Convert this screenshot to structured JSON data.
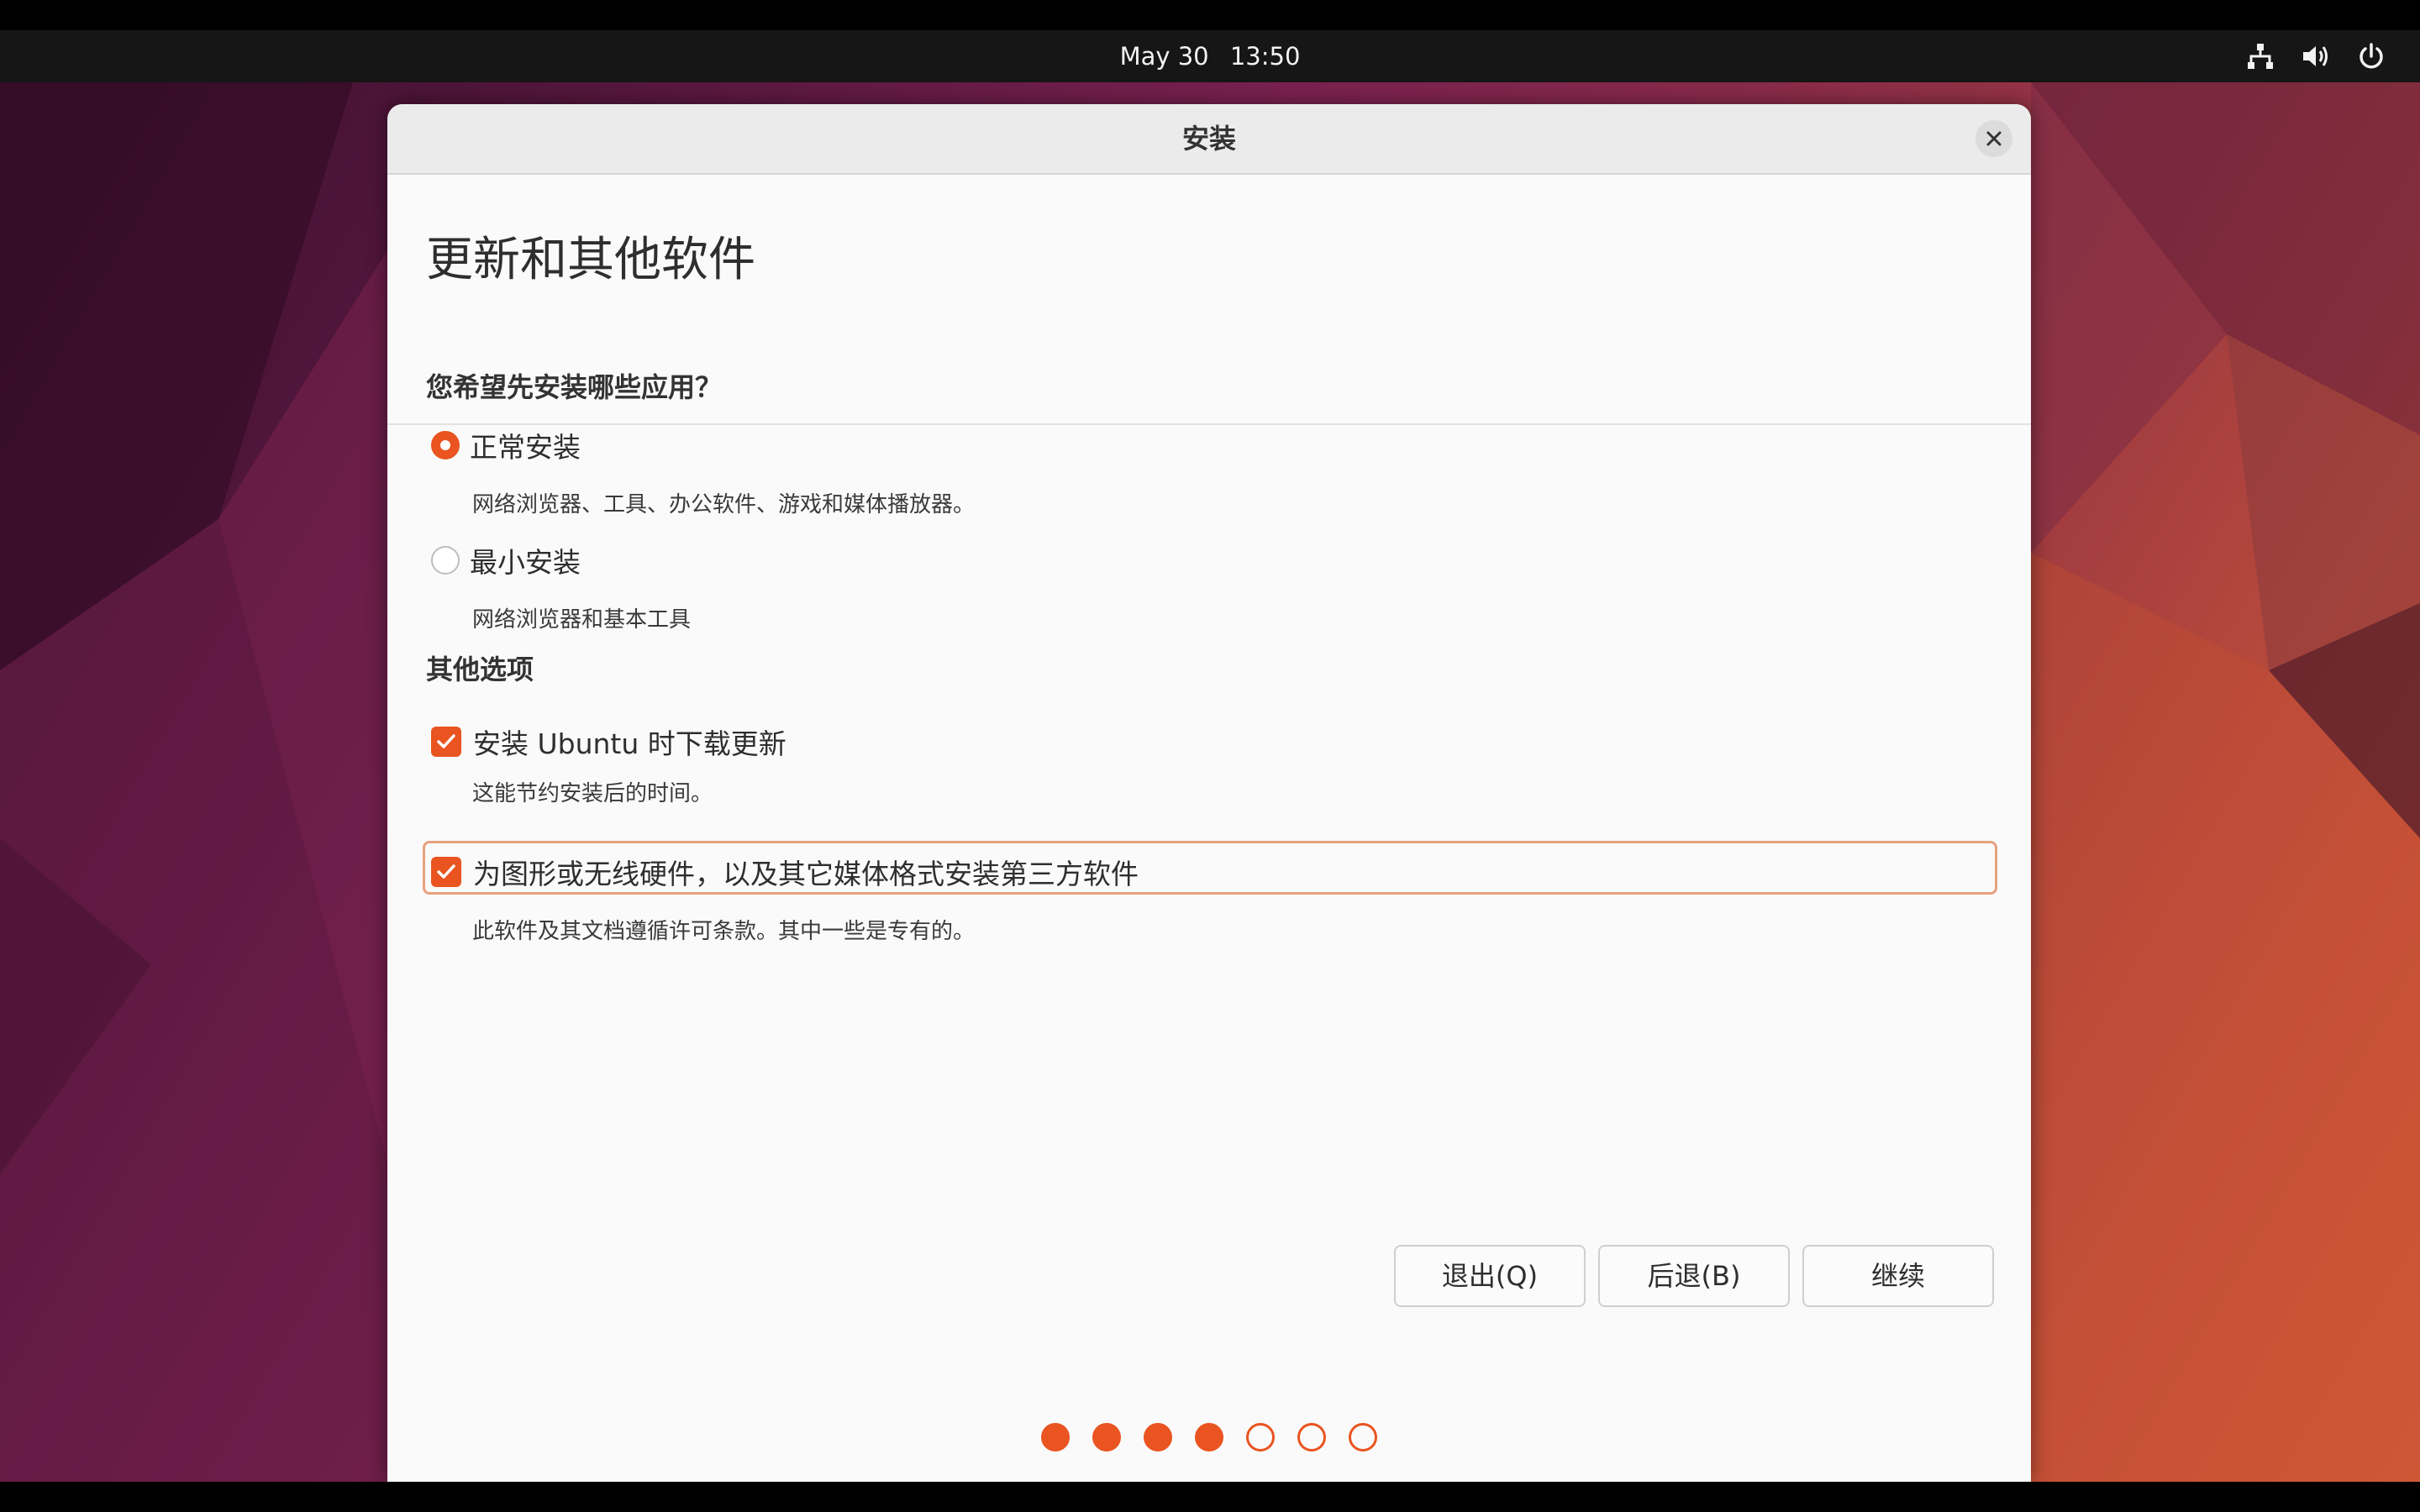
{
  "topbar": {
    "date": "May 30",
    "time": "13:50",
    "icons": [
      "network-icon",
      "volume-icon",
      "power-icon"
    ]
  },
  "window": {
    "title": "安装",
    "page_title": "更新和其他软件",
    "install_type": {
      "heading": "您希望先安装哪些应用？",
      "options": [
        {
          "label": "正常安装",
          "description": "网络浏览器、工具、办公软件、游戏和媒体播放器。",
          "selected": true
        },
        {
          "label": "最小安装",
          "description": "网络浏览器和基本工具",
          "selected": false
        }
      ]
    },
    "other_options": {
      "heading": "其他选项",
      "items": [
        {
          "label": "安装 Ubuntu 时下载更新",
          "description": "这能节约安装后的时间。",
          "checked": true
        },
        {
          "label": "为图形或无线硬件，以及其它媒体格式安装第三方软件",
          "description": "此软件及其文档遵循许可条款。其中一些是专有的。",
          "checked": true
        }
      ]
    },
    "buttons": {
      "quit": "退出(Q)",
      "back": "后退(B)",
      "continue": "继续"
    },
    "progress": {
      "completed_steps": 4,
      "total_steps": 7
    }
  },
  "colors": {
    "accent": "#e95420",
    "topbar": "#161616",
    "window_bg": "#fafafa"
  }
}
